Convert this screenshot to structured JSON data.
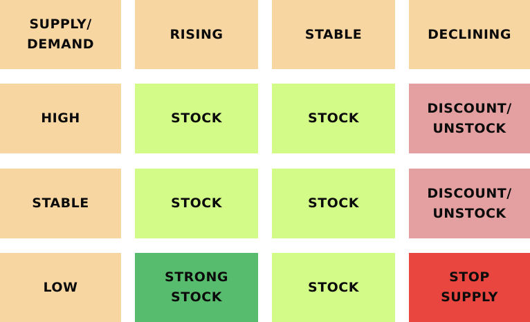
{
  "matrix": {
    "corner": [
      "SUPPLY/",
      "DEMAND"
    ],
    "columns": [
      "RISING",
      "STABLE",
      "DECLINING"
    ],
    "rows": [
      {
        "label": "HIGH",
        "cells": [
          [
            "STOCK"
          ],
          [
            "STOCK"
          ],
          [
            "DISCOUNT/",
            "UNSTOCK"
          ]
        ]
      },
      {
        "label": "STABLE",
        "cells": [
          [
            "STOCK"
          ],
          [
            "STOCK"
          ],
          [
            "DISCOUNT/",
            "UNSTOCK"
          ]
        ]
      },
      {
        "label": "LOW",
        "cells": [
          [
            "STRONG",
            "STOCK"
          ],
          [
            "STOCK"
          ],
          [
            "STOP",
            "SUPPLY"
          ]
        ]
      }
    ]
  },
  "colors": {
    "header": "#f7d6a1",
    "stock": "#d2fb87",
    "discount": "#e4a0a0",
    "strong_stock": "#57bc6d",
    "stop_supply": "#ea4640"
  }
}
